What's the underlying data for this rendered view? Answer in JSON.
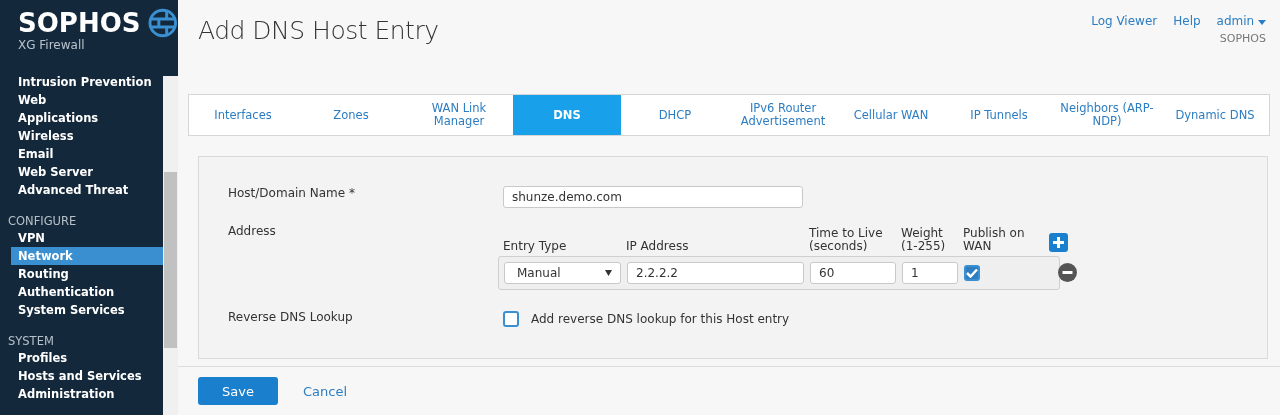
{
  "brand": {
    "logo": "SOPHOS",
    "product": "XG Firewall"
  },
  "sidebar": {
    "sections": [
      {
        "items": [
          {
            "label": "Intrusion Prevention",
            "selected": false
          },
          {
            "label": "Web",
            "selected": false
          },
          {
            "label": "Applications",
            "selected": false
          },
          {
            "label": "Wireless",
            "selected": false
          },
          {
            "label": "Email",
            "selected": false
          },
          {
            "label": "Web Server",
            "selected": false
          },
          {
            "label": "Advanced Threat",
            "selected": false
          }
        ]
      },
      {
        "heading": "CONFIGURE",
        "items": [
          {
            "label": "VPN",
            "selected": false
          },
          {
            "label": "Network",
            "selected": true
          },
          {
            "label": "Routing",
            "selected": false
          },
          {
            "label": "Authentication",
            "selected": false
          },
          {
            "label": "System Services",
            "selected": false
          }
        ]
      },
      {
        "heading": "SYSTEM",
        "items": [
          {
            "label": "Profiles",
            "selected": false
          },
          {
            "label": "Hosts and Services",
            "selected": false
          },
          {
            "label": "Administration",
            "selected": false
          }
        ]
      }
    ]
  },
  "header": {
    "title": "Add DNS Host Entry",
    "links": [
      "Log Viewer",
      "Help"
    ],
    "user": "admin",
    "organization": "SOPHOS"
  },
  "tabs": [
    {
      "label": "Interfaces",
      "selected": false
    },
    {
      "label": "Zones",
      "selected": false
    },
    {
      "label": "WAN Link Manager",
      "selected": false
    },
    {
      "label": "DNS",
      "selected": true
    },
    {
      "label": "DHCP",
      "selected": false
    },
    {
      "label": "IPv6 Router Advertisement",
      "selected": false
    },
    {
      "label": "Cellular WAN",
      "selected": false
    },
    {
      "label": "IP Tunnels",
      "selected": false
    },
    {
      "label": "Neighbors (ARP-NDP)",
      "selected": false
    },
    {
      "label": "Dynamic DNS",
      "selected": false
    }
  ],
  "form": {
    "host_label": "Host/Domain Name *",
    "host_value": "shunze.demo.com",
    "address_label": "Address",
    "address_columns": [
      "Entry Type",
      "IP Address",
      "Time to Live (seconds)",
      "Weight (1-255)",
      "Publish on WAN"
    ],
    "address_rows": [
      {
        "entry_type": "Manual",
        "ip": "2.2.2.2",
        "ttl": "60",
        "weight": "1",
        "publish": true
      }
    ],
    "reverse_label": "Reverse DNS Lookup",
    "reverse_option": {
      "label": "Add reverse DNS lookup for this Host entry",
      "checked": false
    }
  },
  "buttons": {
    "save": "Save",
    "cancel": "Cancel"
  }
}
